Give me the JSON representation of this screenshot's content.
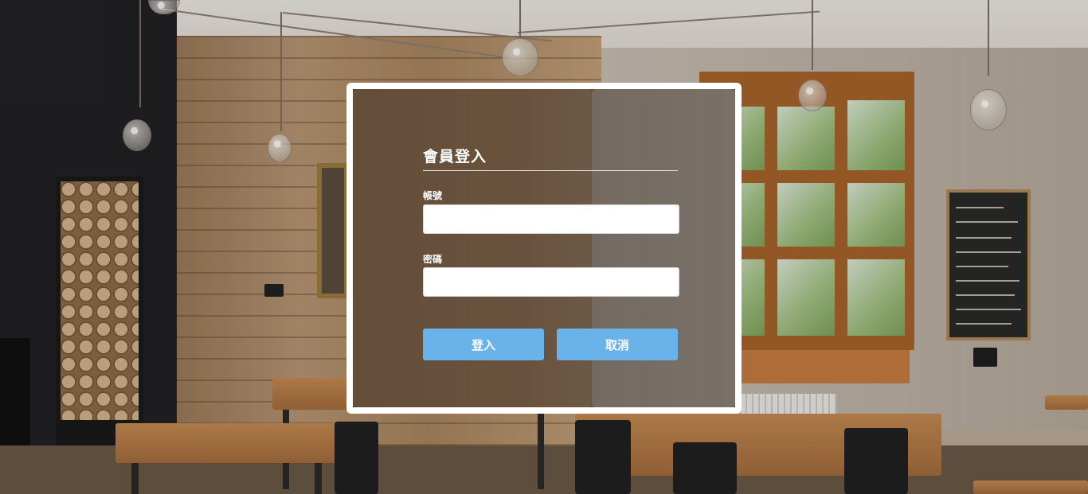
{
  "login": {
    "title": "會員登入",
    "account_label": "帳號",
    "account_value": "",
    "password_label": "密碼",
    "password_value": "",
    "login_button": "登入",
    "cancel_button": "取消"
  },
  "colors": {
    "button": "#6ab3ea",
    "modal_border": "#ffffff",
    "text": "#ffffff"
  }
}
